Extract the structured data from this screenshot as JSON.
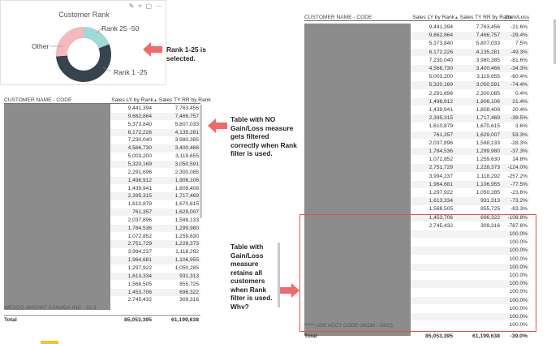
{
  "donut": {
    "title": "Customer Rank",
    "labels": {
      "rank_25_50": "Rank 25 -50",
      "other": "Other",
      "rank_1_25": "Rank 1 -25"
    }
  },
  "notes": {
    "rank_selected": "Rank 1-25 is selected.",
    "no_gainloss": "Table with NO Gain/Loss measure gets filtered correctly when Rank filter is used.",
    "with_gainloss": "Table with Gain/Loss measure retains all customers when Rank filter is used. Why?"
  },
  "left_table": {
    "headers": {
      "name": "CUSTOMER NAME - CODE",
      "ly": "Sales LY by Rank",
      "ty": "Sales TY RR by Rank"
    },
    "rows": [
      [
        "9,441,394",
        "7,763,456"
      ],
      [
        "9,662,864",
        "7,466,757"
      ],
      [
        "5,373,840",
        "5,807,033"
      ],
      [
        "6,172,226",
        "4,135,281"
      ],
      [
        "7,230,040",
        "3,980,385"
      ],
      [
        "4,566,730",
        "3,400,466"
      ],
      [
        "5,003,200",
        "3,119,655"
      ],
      [
        "5,320,169",
        "3,050,591"
      ],
      [
        "2,291,696",
        "2,300,085"
      ],
      [
        "1,498,912",
        "1,906,106"
      ],
      [
        "1,439,941",
        "1,808,408"
      ],
      [
        "2,395,315",
        "1,717,469"
      ],
      [
        "1,610,879",
        "1,670,615"
      ],
      [
        "761,357",
        "1,629,007"
      ],
      [
        "2,037,896",
        "1,588,133"
      ],
      [
        "1,784,536",
        "1,299,980"
      ],
      [
        "1,072,852",
        "1,259,630"
      ],
      [
        "2,751,729",
        "1,228,373"
      ],
      [
        "3,994,237",
        "1,118,292"
      ],
      [
        "1,964,681",
        "1,106,955"
      ],
      [
        "1,297,922",
        "1,050,285"
      ],
      [
        "1,613,334",
        "931,313"
      ],
      [
        "1,568,505",
        "855,725"
      ],
      [
        "1,453,706",
        "696,322"
      ],
      [
        "2,745,432",
        "309,316"
      ]
    ],
    "last_name_partial": "WESCO ANCHAT CANADA INC - 22.3",
    "total_label": "Total",
    "total_ly": "85,053,395",
    "total_ty": "61,199,638"
  },
  "right_table": {
    "headers": {
      "name": "CUSTOMER NAME - CODE",
      "ly": "Sales LY by Rank",
      "ty": "Sales TY RR by Rank",
      "gl": "Gain/Loss"
    },
    "rows": [
      [
        "9,441,394",
        "7,763,456",
        "-21.6%"
      ],
      [
        "9,662,864",
        "7,466,757",
        "-29.4%"
      ],
      [
        "5,373,840",
        "5,807,033",
        "7.5%"
      ],
      [
        "6,172,226",
        "4,135,281",
        "-49.3%"
      ],
      [
        "7,230,040",
        "3,980,385",
        "-81.6%"
      ],
      [
        "4,566,730",
        "3,400,466",
        "-34.3%"
      ],
      [
        "5,003,200",
        "3,119,655",
        "-60.4%"
      ],
      [
        "5,320,169",
        "3,050,591",
        "-74.4%"
      ],
      [
        "2,291,696",
        "2,300,085",
        "0.4%"
      ],
      [
        "1,498,912",
        "1,906,106",
        "21.4%"
      ],
      [
        "1,439,941",
        "1,808,408",
        "20.4%"
      ],
      [
        "2,395,315",
        "1,717,469",
        "-39.5%"
      ],
      [
        "1,610,879",
        "1,670,615",
        "3.6%"
      ],
      [
        "761,357",
        "1,629,007",
        "53.3%"
      ],
      [
        "2,037,896",
        "1,588,133",
        "-28.3%"
      ],
      [
        "1,784,536",
        "1,299,980",
        "-37.3%"
      ],
      [
        "1,072,852",
        "1,259,630",
        "14.8%"
      ],
      [
        "2,751,729",
        "1,228,373",
        "-124.0%"
      ],
      [
        "3,994,237",
        "1,118,292",
        "-257.2%"
      ],
      [
        "1,964,681",
        "1,106,955",
        "-77.5%"
      ],
      [
        "1,297,922",
        "1,050,285",
        "-23.6%"
      ],
      [
        "1,613,334",
        "931,313",
        "-73.2%"
      ],
      [
        "1,568,505",
        "855,725",
        "-83.3%"
      ],
      [
        "1,453,706",
        "696,322",
        "-108.8%"
      ],
      [
        "2,745,432",
        "309,316",
        "-787.6%"
      ],
      [
        "",
        "",
        "100.0%"
      ],
      [
        "",
        "",
        "100.0%"
      ],
      [
        "",
        "",
        "100.0%"
      ],
      [
        "",
        "",
        "100.0%"
      ],
      [
        "",
        "",
        "100.0%"
      ],
      [
        "",
        "",
        "100.0%"
      ],
      [
        "",
        "",
        "100.0%"
      ],
      [
        "",
        "",
        "100.0%"
      ],
      [
        "",
        "",
        "100.0%"
      ],
      [
        "",
        "",
        "100.0%"
      ],
      [
        "",
        "",
        "100.0%"
      ],
      [
        "",
        "",
        "100.0%"
      ]
    ],
    "last_name_partial": "***** USE ACCT CODE OKDM - OKD)",
    "total_label": "Total",
    "total_ly": "85,053,395",
    "total_ty": "61,199,638",
    "total_gl": "-39.0%"
  },
  "colors": {
    "teal": "#a0dad8",
    "pink": "#f4b9bc",
    "dark": "#37444d",
    "red": "#f06a6a"
  }
}
